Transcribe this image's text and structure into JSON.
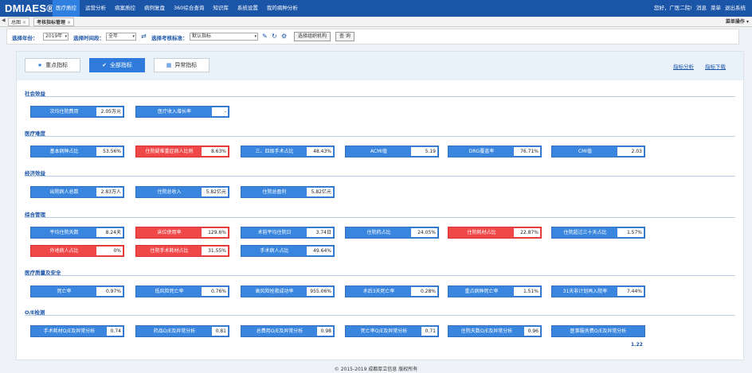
{
  "header": {
    "logo": "DMIAES®",
    "nav": [
      "医疗质控",
      "运营分析",
      "病案质控",
      "病例复盘",
      "360综合查询",
      "知识库",
      "系统设置",
      "我的病种分析"
    ],
    "active_nav": 0,
    "right_links": [
      "您好，广医二院!",
      "消息",
      "菜单",
      "退出系统"
    ]
  },
  "tabbar": {
    "tabs": [
      "总图",
      "考核指标管理"
    ],
    "menu_op": "菜单操作"
  },
  "filters": {
    "year_label": "选择年份：",
    "year_value": "2019年",
    "period_label": "选择时间段：",
    "period_value": "全年",
    "standard_label": "选择考核标准：",
    "standard_value": "默认指标",
    "org_button": "选择组织机构",
    "query_button": "查 询"
  },
  "main_tabs": {
    "key_label": "重点指标",
    "all_label": "全部指标",
    "abnormal_label": "异常指标",
    "link_analysis": "指标分析",
    "link_download": "指标下载"
  },
  "sections": [
    {
      "title": "社会效益",
      "cards": [
        {
          "label": "次均住院费用",
          "value": "2.05万元",
          "state": "normal"
        },
        {
          "label": "医疗收入增长率",
          "value": "-",
          "state": "normal"
        }
      ]
    },
    {
      "title": "医疗难度",
      "cards": [
        {
          "label": "基本病种占比",
          "value": "53.56%",
          "state": "normal"
        },
        {
          "label": "住院疑难重症病人比例",
          "value": "8.63%",
          "state": "alert"
        },
        {
          "label": "三、四级手术占比",
          "value": "48.43%",
          "state": "normal"
        },
        {
          "label": "ACMI值",
          "value": "5.19",
          "state": "normal"
        },
        {
          "label": "DRG覆盖率",
          "value": "76.71%",
          "state": "normal"
        },
        {
          "label": "CMI值",
          "value": "2.03",
          "state": "normal"
        }
      ]
    },
    {
      "title": "经济效益",
      "cards": [
        {
          "label": "出院病人总数",
          "value": "2.83万人",
          "state": "normal"
        },
        {
          "label": "住院总收入",
          "value": "5.82亿元",
          "state": "normal"
        },
        {
          "label": "住院总盈利",
          "value": "5.82亿元",
          "state": "normal"
        }
      ]
    },
    {
      "title": "综合管理",
      "cards": [
        {
          "label": "平均住院天数",
          "value": "8.24天",
          "state": "normal"
        },
        {
          "label": "床位使用率",
          "value": "129.6%",
          "state": "alert"
        },
        {
          "label": "术前平均住院日",
          "value": "3.74日",
          "state": "normal"
        },
        {
          "label": "住院药占比",
          "value": "24.05%",
          "state": "normal"
        },
        {
          "label": "住院耗材占比",
          "value": "22.87%",
          "state": "alert"
        },
        {
          "label": "住院超过三十天占比",
          "value": "1.57%",
          "state": "normal"
        },
        {
          "label": "外地病人占比",
          "value": "0%",
          "state": "alert"
        },
        {
          "label": "住院手术耗材占比",
          "value": "31.55%",
          "state": "alert"
        },
        {
          "label": "手术病人占比",
          "value": "49.64%",
          "state": "normal"
        }
      ]
    },
    {
      "title": "医疗质量及安全",
      "cards": [
        {
          "label": "死亡率",
          "value": "0.97%",
          "state": "normal"
        },
        {
          "label": "低风险死亡率",
          "value": "0.76%",
          "state": "normal"
        },
        {
          "label": "高风险抢救成功率",
          "value": "955.06%",
          "state": "normal"
        },
        {
          "label": "术后3天死亡率",
          "value": "0.28%",
          "state": "normal"
        },
        {
          "label": "重点病种死亡率",
          "value": "1.51%",
          "state": "normal"
        },
        {
          "label": "31天非计划再入院率",
          "value": "7.44%",
          "state": "normal"
        }
      ]
    },
    {
      "title": "O/E检测",
      "cards": [
        {
          "label": "手术耗材O/E及异常分析",
          "value": "0.74",
          "state": "normal"
        },
        {
          "label": "药品O/E及异常分析",
          "value": "0.81",
          "state": "normal"
        },
        {
          "label": "总费用O/E及异常分析",
          "value": "0.98",
          "state": "normal"
        },
        {
          "label": "死亡率O/E及异常分析",
          "value": "0.71",
          "state": "normal"
        },
        {
          "label": "住院天数O/E及异常分析",
          "value": "0.96",
          "state": "normal"
        },
        {
          "label": "医事服务费O/E及异常分析",
          "value": "1.22",
          "state": "normal"
        }
      ]
    }
  ],
  "footer": "© 2015-2019 成都厚立信息 版权所有",
  "colors": {
    "primary": "#3a86de",
    "alert": "#f04848",
    "header": "#1b55a8"
  }
}
